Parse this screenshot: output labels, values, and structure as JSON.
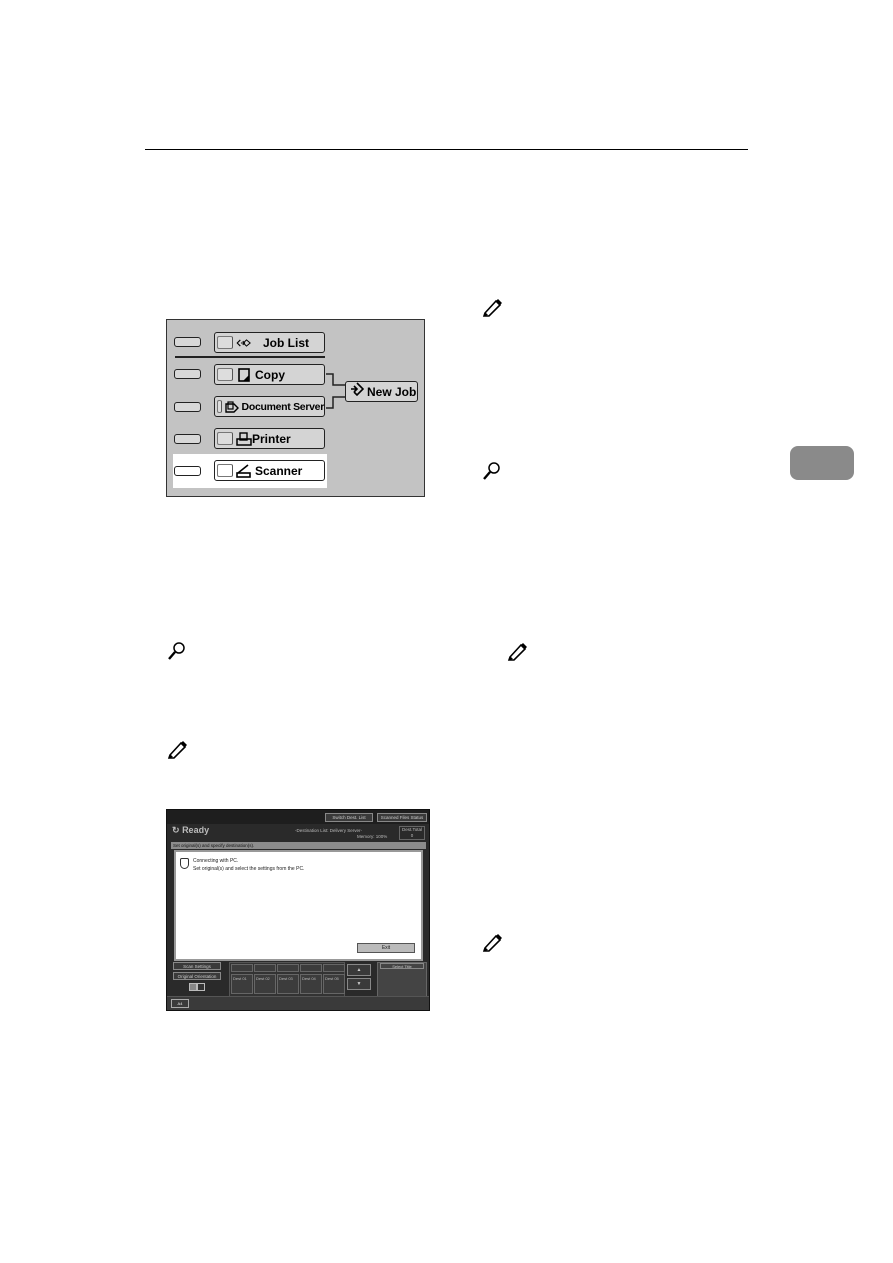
{
  "page": {
    "side_tab_color": "#8a8a8a"
  },
  "function_keys": {
    "items": [
      {
        "label": "Job List",
        "icon": "job-list-icon"
      },
      {
        "label": "Copy",
        "icon": "copy-icon"
      },
      {
        "label": "Document Server",
        "icon": "document-server-icon"
      },
      {
        "label": "Printer",
        "icon": "printer-icon"
      },
      {
        "label": "Scanner",
        "icon": "scanner-icon",
        "highlighted": true
      }
    ],
    "new_job_label": "New Job",
    "new_job_icon": "new-job-icon",
    "panel_color": "#c3c3c3"
  },
  "markers": {
    "note_icon": "note-pencil-icon",
    "reference_icon": "reference-magnifier-icon"
  },
  "scanner_screen": {
    "top_buttons": [
      "Switch Dest. List",
      "Scanned Files Status"
    ],
    "status": "Ready",
    "destination_text": "-Destination List: Delivery Server-",
    "memory_label": "Memory:",
    "memory_value": "100%",
    "counter_label": "Dest.Total",
    "counter_value": "0",
    "instruction_bar": "Set original(s) and specify destination(s).",
    "dialog": {
      "line1": "Connecting with PC.",
      "line2": "Set original(s) and select the settings from the PC.",
      "exit_label": "Exit"
    },
    "left_buttons": [
      "Scan Settings",
      "Original Orientation"
    ],
    "destination_cells": [
      [
        "",
        "",
        "",
        "",
        ""
      ],
      [
        "Dest 01",
        "Dest 02",
        "Dest 03",
        "Dest 04",
        "Dest 05"
      ]
    ],
    "arrow_up": "▲",
    "arrow_down": "▼",
    "right_panel_button": "Select Title",
    "tray_label": "A4"
  }
}
